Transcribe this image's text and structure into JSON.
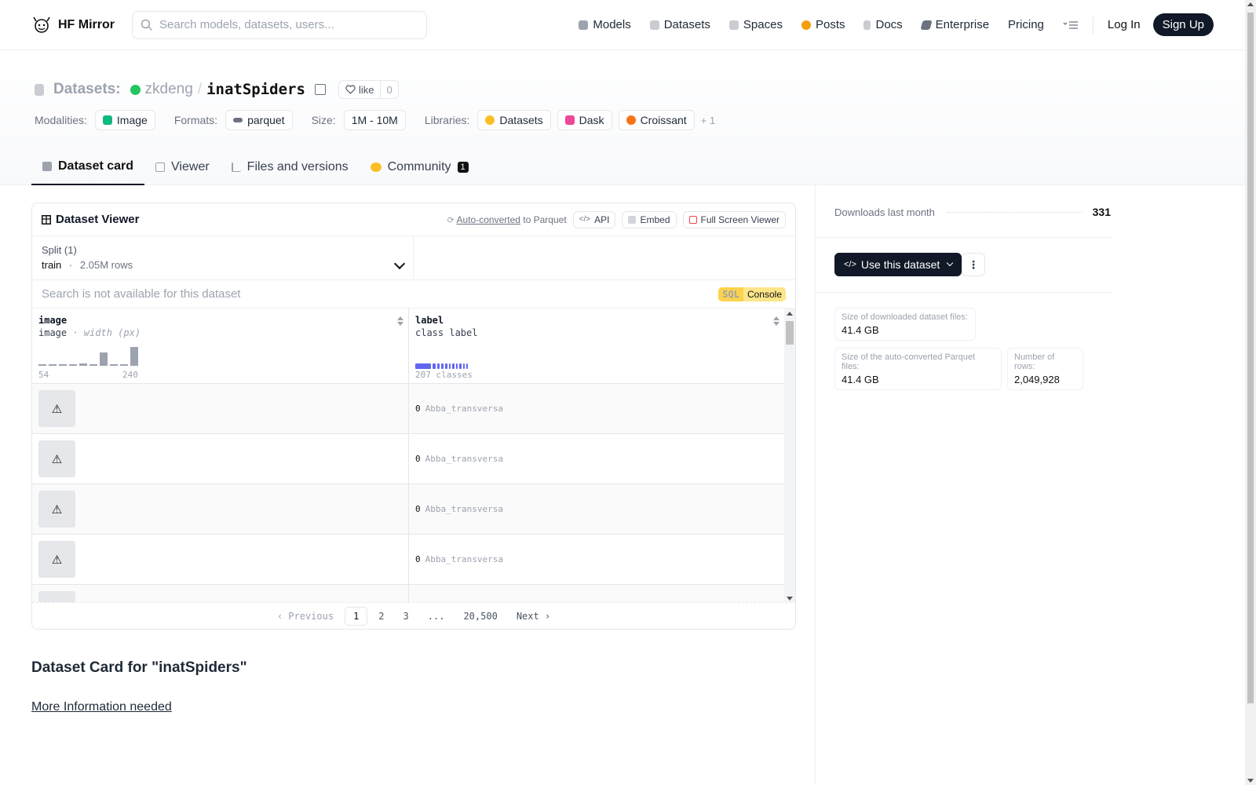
{
  "nav": {
    "brand": "HF Mirror",
    "search_placeholder": "Search models, datasets, users...",
    "links": [
      {
        "label": "Models",
        "icon": "cube-icon",
        "color": "#9ca3af"
      },
      {
        "label": "Datasets",
        "icon": "database-icon",
        "color": "#9ca3af"
      },
      {
        "label": "Spaces",
        "icon": "grid-icon",
        "color": "#9ca3af"
      },
      {
        "label": "Posts",
        "icon": "chat-icon",
        "color": "#f59e0b"
      },
      {
        "label": "Docs",
        "icon": "book-icon",
        "color": "#9ca3af"
      },
      {
        "label": "Enterprise",
        "icon": "enterprise-icon",
        "color": "#6b7280"
      },
      {
        "label": "Pricing"
      }
    ],
    "login": "Log In",
    "signup": "Sign Up"
  },
  "header": {
    "datasets_label": "Datasets:",
    "owner": "zkdeng",
    "separator": "/",
    "name": "inatSpiders",
    "like_label": "like",
    "like_count": "0",
    "modalities_label": "Modalities:",
    "modality": "Image",
    "formats_label": "Formats:",
    "format": "parquet",
    "size_label": "Size:",
    "size": "1M - 10M",
    "libraries_label": "Libraries:",
    "libraries": [
      "Datasets",
      "Dask",
      "Croissant"
    ],
    "libraries_more": "+ 1"
  },
  "tabs": [
    {
      "label": "Dataset card",
      "active": true
    },
    {
      "label": "Viewer"
    },
    {
      "label": "Files and versions"
    },
    {
      "label": "Community",
      "badge": "1"
    }
  ],
  "viewer": {
    "title": "Dataset Viewer",
    "auto_converted": "Auto-converted",
    "to_parquet": "to Parquet",
    "api": "API",
    "embed": "Embed",
    "fullscreen": "Full Screen Viewer",
    "split_label": "Split (1)",
    "split_name": "train",
    "split_dot": "·",
    "split_rows": "2.05M rows",
    "search_placeholder": "Search is not available for this dataset",
    "sql": "SQL",
    "console": "Console",
    "columns": [
      {
        "name": "image",
        "type": "image",
        "sub": "· width (px)",
        "min": "54",
        "max": "240"
      },
      {
        "name": "label",
        "type": "class label",
        "classes": "207 classes"
      }
    ],
    "width_histogram": [
      0.02,
      0.02,
      0.02,
      0.02,
      0.1,
      0.02,
      0.6,
      0.02,
      0.02,
      0.85
    ],
    "class_bar": [
      0.32,
      0.05,
      0.05,
      0.05,
      0.04,
      0.04,
      0.04,
      0.04,
      0.04,
      0.03,
      0.03
    ],
    "rows": [
      {
        "image": "⚠",
        "label_id": "0",
        "label_name": "Abba_transversa"
      },
      {
        "image": "⚠",
        "label_id": "0",
        "label_name": "Abba_transversa"
      },
      {
        "image": "⚠",
        "label_id": "0",
        "label_name": "Abba_transversa"
      },
      {
        "image": "⚠",
        "label_id": "0",
        "label_name": "Abba_transversa"
      },
      {
        "image": "⚠",
        "label_id": "",
        "label_name": ""
      }
    ],
    "pager": {
      "previous": "Previous",
      "pages": [
        "1",
        "2",
        "3",
        "...",
        "20,500"
      ],
      "next": "Next"
    }
  },
  "card": {
    "title": "Dataset Card for \"inatSpiders\"",
    "more_info": "More Information needed"
  },
  "sidebar": {
    "downloads_label": "Downloads last month",
    "downloads_value": "331",
    "use_dataset": "Use this dataset",
    "more": "⋮",
    "stats": [
      {
        "key": "Size of downloaded dataset files:",
        "value": "41.4 GB"
      },
      {
        "key": "Size of the auto-converted Parquet files:",
        "value": "41.4 GB"
      },
      {
        "key": "Number of rows:",
        "value": "2,049,928"
      }
    ]
  }
}
